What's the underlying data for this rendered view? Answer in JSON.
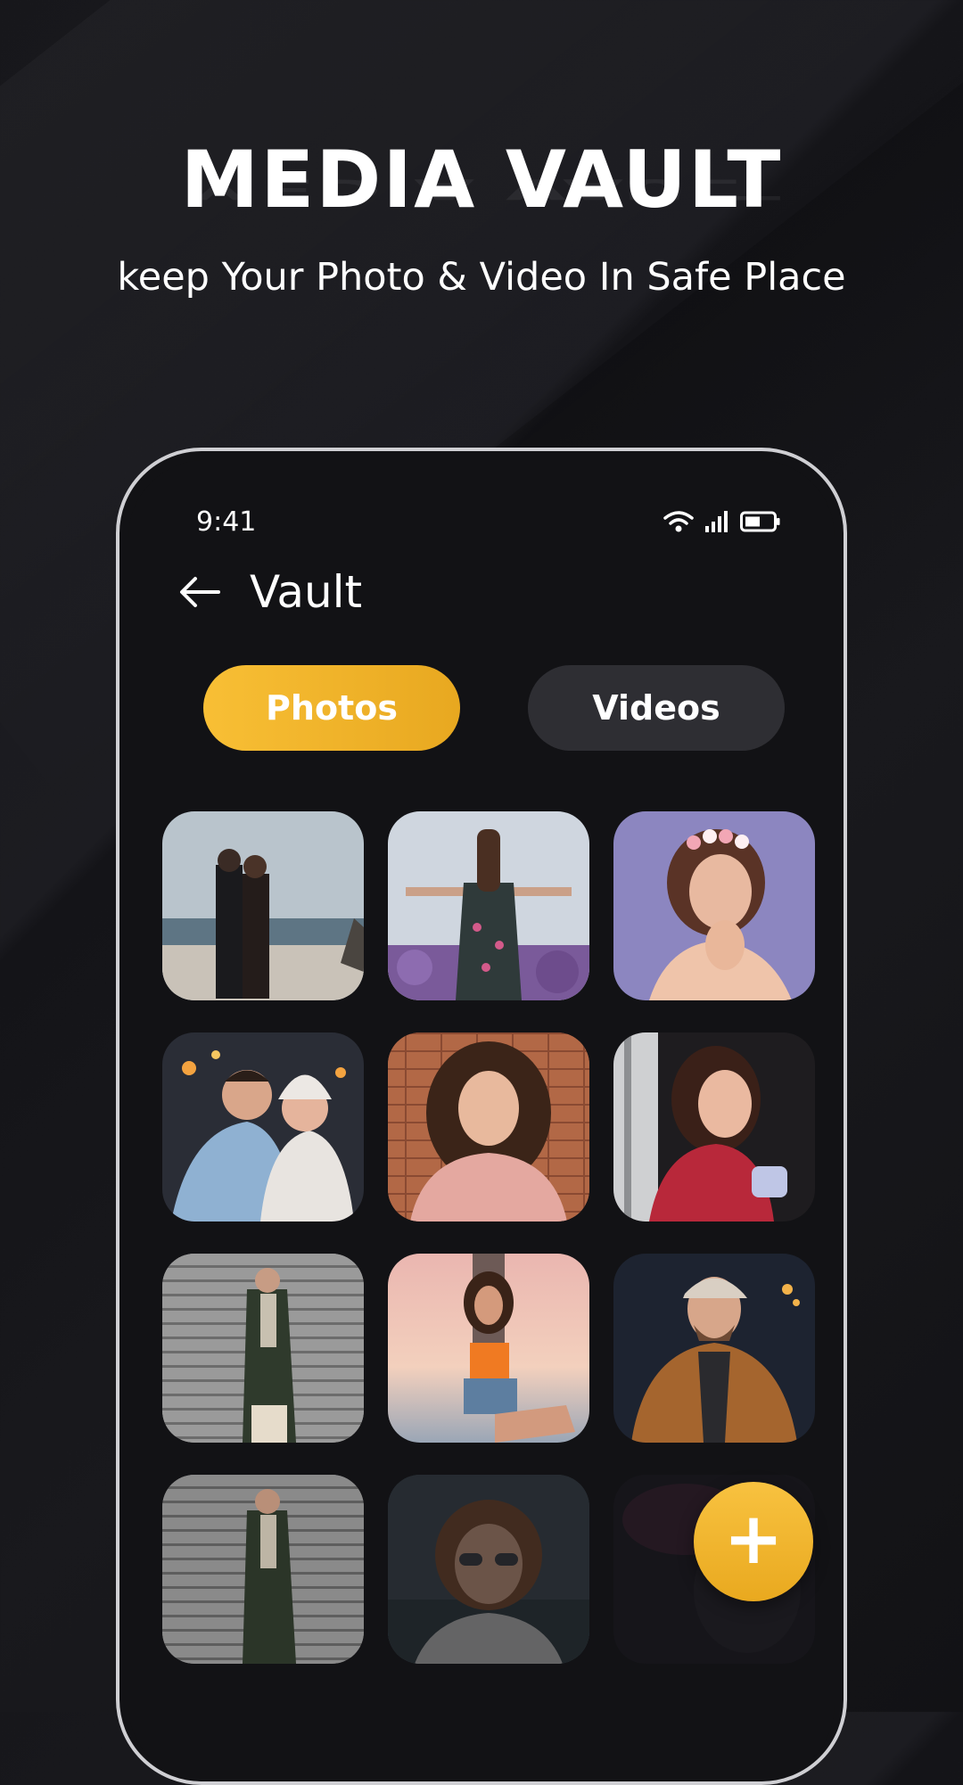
{
  "promo": {
    "headline": "MEDIA VAULT",
    "subheadline": "keep Your Photo & Video In Safe Place"
  },
  "status_bar": {
    "time": "9:41",
    "icons": [
      "wifi-icon",
      "signal-icon",
      "battery-icon"
    ]
  },
  "app_bar": {
    "back_icon": "arrow-left-icon",
    "title": "Vault"
  },
  "tabs": [
    {
      "label": "Photos",
      "selected": true
    },
    {
      "label": "Videos",
      "selected": false
    }
  ],
  "grid": {
    "photos": [
      "couple-on-beach",
      "woman-in-lavender-field",
      "woman-with-flower-crown",
      "couple-in-winter-hats",
      "woman-curly-hair-pink-sweater",
      "woman-red-plaid-shirt-with-cup",
      "man-green-coat-by-wall",
      "woman-orange-top-at-sunset",
      "man-cap-brown-jacket",
      "man-green-coat-by-wall",
      "man-curly-hair-sunglasses",
      "dark-photo-partially-hidden"
    ]
  },
  "fab": {
    "icon": "plus-icon"
  },
  "colors": {
    "accent": "#F5B52E",
    "background": "#121215",
    "tab_inactive": "#2E2E33"
  }
}
